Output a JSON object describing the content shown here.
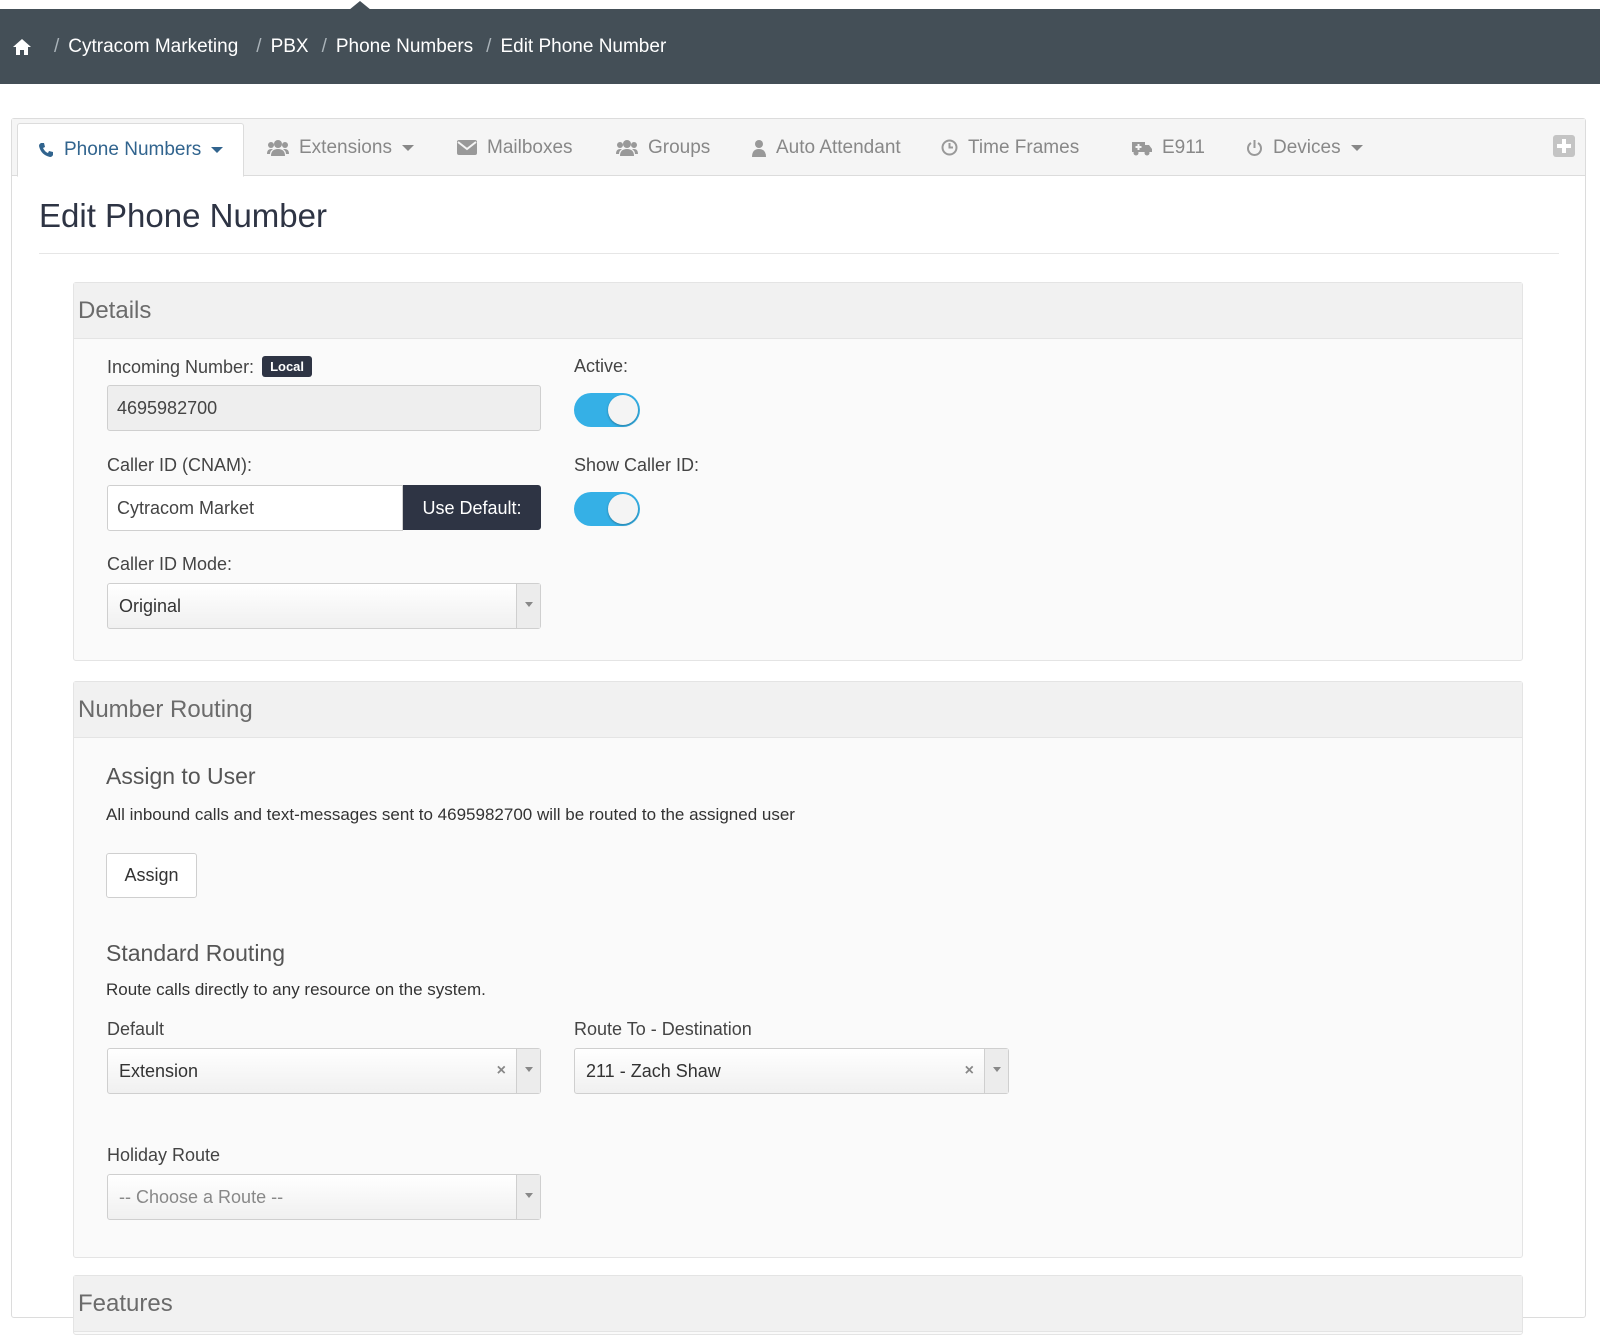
{
  "breadcrumb": {
    "items": [
      "Cytracom Marketing",
      "PBX",
      "Phone Numbers",
      "Edit Phone Number"
    ]
  },
  "tabs": [
    {
      "label": "Phone Numbers",
      "icon": "phone-icon",
      "active": true,
      "dropdown": true
    },
    {
      "label": "Extensions",
      "icon": "users-icon",
      "active": false,
      "dropdown": true
    },
    {
      "label": "Mailboxes",
      "icon": "envelope-icon",
      "active": false,
      "dropdown": false
    },
    {
      "label": "Groups",
      "icon": "users-icon",
      "active": false,
      "dropdown": false
    },
    {
      "label": "Auto Attendant",
      "icon": "user-icon",
      "active": false,
      "dropdown": false
    },
    {
      "label": "Time Frames",
      "icon": "clock-icon",
      "active": false,
      "dropdown": false
    },
    {
      "label": "E911",
      "icon": "ambulance-icon",
      "active": false,
      "dropdown": false
    },
    {
      "label": "Devices",
      "icon": "power-icon",
      "active": false,
      "dropdown": true
    }
  ],
  "page": {
    "title": "Edit Phone Number"
  },
  "details": {
    "heading": "Details",
    "incoming_label": "Incoming Number:",
    "incoming_badge": "Local",
    "incoming_value": "4695982700",
    "active_label": "Active:",
    "active_on": true,
    "callerid_label": "Caller ID (CNAM):",
    "callerid_value": "Cytracom Market",
    "use_default_label": "Use Default:",
    "show_callerid_label": "Show Caller ID:",
    "show_callerid_on": true,
    "mode_label": "Caller ID Mode:",
    "mode_value": "Original"
  },
  "routing": {
    "heading": "Number Routing",
    "assign_heading": "Assign to User",
    "assign_text": "All inbound calls and text-messages sent to 4695982700 will be routed to the assigned user",
    "assign_button": "Assign",
    "standard_heading": "Standard Routing",
    "standard_text": "Route calls directly to any resource on the system.",
    "default_label": "Default",
    "default_value": "Extension",
    "destination_label": "Route To - Destination",
    "destination_value": "211 - Zach Shaw",
    "holiday_label": "Holiday Route",
    "holiday_placeholder": "-- Choose a Route --",
    "clear_glyph": "×"
  },
  "features": {
    "heading": "Features"
  },
  "colors": {
    "topbar": "#444f57",
    "accent": "#35b0e6",
    "dark": "#2e3444",
    "active_tab": "#31648e"
  }
}
